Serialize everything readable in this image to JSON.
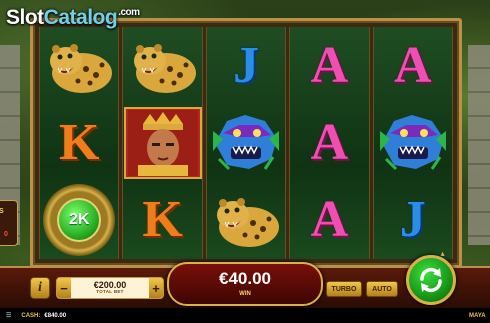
{
  "branding": {
    "logo_main": "Slot",
    "logo_accent": "Catalog",
    "logo_suffix": ".com"
  },
  "reels": [
    [
      "jaguar",
      "K",
      "bonus"
    ],
    [
      "jaguar",
      "king",
      "K"
    ],
    [
      "J",
      "serpent",
      "jaguar"
    ],
    [
      "A",
      "A",
      "A"
    ],
    [
      "A",
      "serpent",
      "J"
    ]
  ],
  "bonus": {
    "value": "2K"
  },
  "side_panel": {
    "label": "US",
    "value": "0"
  },
  "controls": {
    "info_label": "i",
    "bet_minus": "−",
    "bet_plus": "+",
    "total_bet": "€200.00",
    "total_bet_label": "TOTAL BET",
    "win_value": "€40.00",
    "win_label": "WIN",
    "turbo_label": "TURBO",
    "auto_label": "AUTO"
  },
  "status": {
    "cash_label": "CASH:",
    "cash_value": "€840.00",
    "game_name": "MAYA"
  },
  "colors": {
    "k": "#f07d1c",
    "a": "#f04fb2",
    "j": "#2a8ee8",
    "frame": "#b99249",
    "spin": "#138a13"
  }
}
